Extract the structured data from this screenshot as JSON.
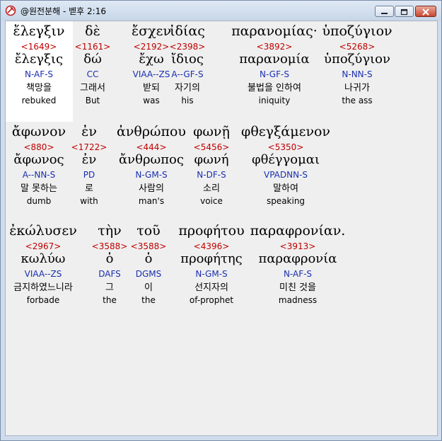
{
  "window": {
    "title": "@원전분해 - 벧후 2:16",
    "min_icon": "minimize-icon",
    "max_icon": "maximize-icon",
    "close_icon": "close-icon",
    "app_icon": "app-icon"
  },
  "colors": {
    "strongs": "#c00000",
    "parsing": "#1a2fb0",
    "highlight": "#ffffff",
    "background": "#efefef"
  },
  "rows": [
    {
      "words": [
        {
          "greek": "ἔλεγξιν",
          "strongs": "<1649>",
          "lemma": "ἔλεγξις",
          "parsing": "N-AF-S",
          "korean": "책망을",
          "english": "rebuked",
          "highlighted": true
        },
        {
          "greek": "δὲ",
          "strongs": "<1161>",
          "lemma": "δώ",
          "parsing": "CC",
          "korean": "그래서",
          "english": "But"
        },
        {
          "greek": "ἔσχεν",
          "strongs": "<2192>",
          "lemma": "ἔχω",
          "parsing": "VIAA--ZS",
          "korean": "받되",
          "english": "was"
        },
        {
          "greek": "ἰδίας",
          "strongs": "<2398>",
          "lemma": "ἴδιος",
          "parsing": "A--GF-S",
          "korean": "자기의",
          "english": "his"
        },
        {
          "greek": "παρανομίας·",
          "strongs": "<3892>",
          "lemma": "παρανομία",
          "parsing": "N-GF-S",
          "korean": "불법을 인하여",
          "english": "iniquity"
        },
        {
          "greek": "ὑποζύγιον",
          "strongs": "<5268>",
          "lemma": "ὑποζύγιον",
          "parsing": "N-NN-S",
          "korean": "나귀가",
          "english": "the ass"
        }
      ]
    },
    {
      "words": [
        {
          "greek": "ἄφωνον",
          "strongs": "<880>",
          "lemma": "ἄφωνος",
          "parsing": "A--NN-S",
          "korean": "말 못하는",
          "english": "dumb"
        },
        {
          "greek": "ἐν",
          "strongs": "<1722>",
          "lemma": "ἐν",
          "parsing": "PD",
          "korean": "로",
          "english": "with"
        },
        {
          "greek": "ἀνθρώπου",
          "strongs": "<444>",
          "lemma": "ἄνθρωπος",
          "parsing": "N-GM-S",
          "korean": "사람의",
          "english": "man's"
        },
        {
          "greek": "φωνῇ",
          "strongs": "<5456>",
          "lemma": "φωνή",
          "parsing": "N-DF-S",
          "korean": "소리",
          "english": "voice"
        },
        {
          "greek": "φθεγξάμενον",
          "strongs": "<5350>",
          "lemma": "φθέγγομαι",
          "parsing": "VPADNN-S",
          "korean": "말하여",
          "english": "speaking"
        }
      ]
    },
    {
      "words": [
        {
          "greek": "ἐκώλυσεν",
          "strongs": "<2967>",
          "lemma": "κωλύω",
          "parsing": "VIAA--ZS",
          "korean": "금지하였느니라",
          "english": "forbade"
        },
        {
          "greek": "τὴν",
          "strongs": "<3588>",
          "lemma": "ὁ",
          "parsing": "DAFS",
          "korean": "그",
          "english": "the"
        },
        {
          "greek": "τοῦ",
          "strongs": "<3588>",
          "lemma": "ὁ",
          "parsing": "DGMS",
          "korean": "이",
          "english": "the"
        },
        {
          "greek": "προφήτου",
          "strongs": "<4396>",
          "lemma": "προφήτης",
          "parsing": "N-GM-S",
          "korean": "선지자의",
          "english": "of-prophet"
        },
        {
          "greek": "παραφρονίαν.",
          "strongs": "<3913>",
          "lemma": "παραφρονία",
          "parsing": "N-AF-S",
          "korean": "미친 것을",
          "english": "madness"
        }
      ]
    }
  ]
}
